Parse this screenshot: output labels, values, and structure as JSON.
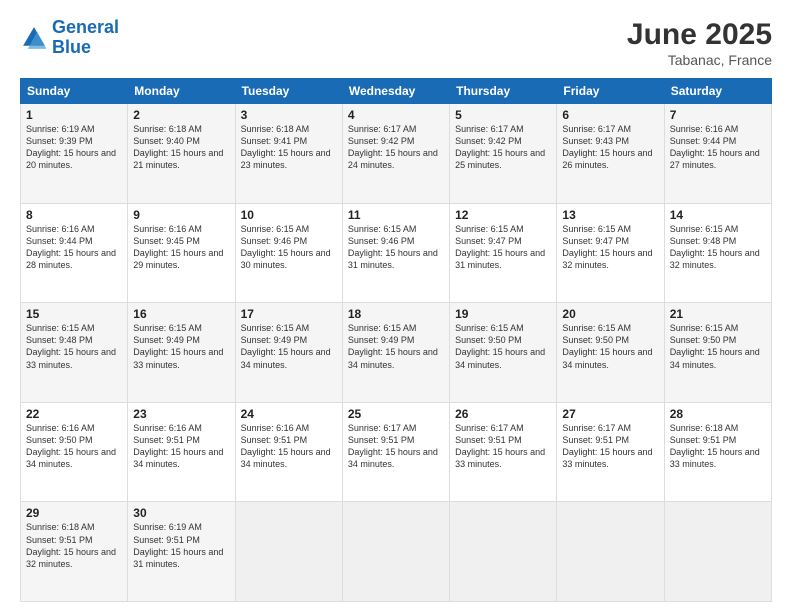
{
  "logo": {
    "line1": "General",
    "line2": "Blue"
  },
  "header": {
    "month_year": "June 2025",
    "location": "Tabanac, France"
  },
  "columns": [
    "Sunday",
    "Monday",
    "Tuesday",
    "Wednesday",
    "Thursday",
    "Friday",
    "Saturday"
  ],
  "rows": [
    [
      {
        "day": "1",
        "sunrise": "Sunrise: 6:19 AM",
        "sunset": "Sunset: 9:39 PM",
        "daylight": "Daylight: 15 hours and 20 minutes."
      },
      {
        "day": "2",
        "sunrise": "Sunrise: 6:18 AM",
        "sunset": "Sunset: 9:40 PM",
        "daylight": "Daylight: 15 hours and 21 minutes."
      },
      {
        "day": "3",
        "sunrise": "Sunrise: 6:18 AM",
        "sunset": "Sunset: 9:41 PM",
        "daylight": "Daylight: 15 hours and 23 minutes."
      },
      {
        "day": "4",
        "sunrise": "Sunrise: 6:17 AM",
        "sunset": "Sunset: 9:42 PM",
        "daylight": "Daylight: 15 hours and 24 minutes."
      },
      {
        "day": "5",
        "sunrise": "Sunrise: 6:17 AM",
        "sunset": "Sunset: 9:42 PM",
        "daylight": "Daylight: 15 hours and 25 minutes."
      },
      {
        "day": "6",
        "sunrise": "Sunrise: 6:17 AM",
        "sunset": "Sunset: 9:43 PM",
        "daylight": "Daylight: 15 hours and 26 minutes."
      },
      {
        "day": "7",
        "sunrise": "Sunrise: 6:16 AM",
        "sunset": "Sunset: 9:44 PM",
        "daylight": "Daylight: 15 hours and 27 minutes."
      }
    ],
    [
      {
        "day": "8",
        "sunrise": "Sunrise: 6:16 AM",
        "sunset": "Sunset: 9:44 PM",
        "daylight": "Daylight: 15 hours and 28 minutes."
      },
      {
        "day": "9",
        "sunrise": "Sunrise: 6:16 AM",
        "sunset": "Sunset: 9:45 PM",
        "daylight": "Daylight: 15 hours and 29 minutes."
      },
      {
        "day": "10",
        "sunrise": "Sunrise: 6:15 AM",
        "sunset": "Sunset: 9:46 PM",
        "daylight": "Daylight: 15 hours and 30 minutes."
      },
      {
        "day": "11",
        "sunrise": "Sunrise: 6:15 AM",
        "sunset": "Sunset: 9:46 PM",
        "daylight": "Daylight: 15 hours and 31 minutes."
      },
      {
        "day": "12",
        "sunrise": "Sunrise: 6:15 AM",
        "sunset": "Sunset: 9:47 PM",
        "daylight": "Daylight: 15 hours and 31 minutes."
      },
      {
        "day": "13",
        "sunrise": "Sunrise: 6:15 AM",
        "sunset": "Sunset: 9:47 PM",
        "daylight": "Daylight: 15 hours and 32 minutes."
      },
      {
        "day": "14",
        "sunrise": "Sunrise: 6:15 AM",
        "sunset": "Sunset: 9:48 PM",
        "daylight": "Daylight: 15 hours and 32 minutes."
      }
    ],
    [
      {
        "day": "15",
        "sunrise": "Sunrise: 6:15 AM",
        "sunset": "Sunset: 9:48 PM",
        "daylight": "Daylight: 15 hours and 33 minutes."
      },
      {
        "day": "16",
        "sunrise": "Sunrise: 6:15 AM",
        "sunset": "Sunset: 9:49 PM",
        "daylight": "Daylight: 15 hours and 33 minutes."
      },
      {
        "day": "17",
        "sunrise": "Sunrise: 6:15 AM",
        "sunset": "Sunset: 9:49 PM",
        "daylight": "Daylight: 15 hours and 34 minutes."
      },
      {
        "day": "18",
        "sunrise": "Sunrise: 6:15 AM",
        "sunset": "Sunset: 9:49 PM",
        "daylight": "Daylight: 15 hours and 34 minutes."
      },
      {
        "day": "19",
        "sunrise": "Sunrise: 6:15 AM",
        "sunset": "Sunset: 9:50 PM",
        "daylight": "Daylight: 15 hours and 34 minutes."
      },
      {
        "day": "20",
        "sunrise": "Sunrise: 6:15 AM",
        "sunset": "Sunset: 9:50 PM",
        "daylight": "Daylight: 15 hours and 34 minutes."
      },
      {
        "day": "21",
        "sunrise": "Sunrise: 6:15 AM",
        "sunset": "Sunset: 9:50 PM",
        "daylight": "Daylight: 15 hours and 34 minutes."
      }
    ],
    [
      {
        "day": "22",
        "sunrise": "Sunrise: 6:16 AM",
        "sunset": "Sunset: 9:50 PM",
        "daylight": "Daylight: 15 hours and 34 minutes."
      },
      {
        "day": "23",
        "sunrise": "Sunrise: 6:16 AM",
        "sunset": "Sunset: 9:51 PM",
        "daylight": "Daylight: 15 hours and 34 minutes."
      },
      {
        "day": "24",
        "sunrise": "Sunrise: 6:16 AM",
        "sunset": "Sunset: 9:51 PM",
        "daylight": "Daylight: 15 hours and 34 minutes."
      },
      {
        "day": "25",
        "sunrise": "Sunrise: 6:17 AM",
        "sunset": "Sunset: 9:51 PM",
        "daylight": "Daylight: 15 hours and 34 minutes."
      },
      {
        "day": "26",
        "sunrise": "Sunrise: 6:17 AM",
        "sunset": "Sunset: 9:51 PM",
        "daylight": "Daylight: 15 hours and 33 minutes."
      },
      {
        "day": "27",
        "sunrise": "Sunrise: 6:17 AM",
        "sunset": "Sunset: 9:51 PM",
        "daylight": "Daylight: 15 hours and 33 minutes."
      },
      {
        "day": "28",
        "sunrise": "Sunrise: 6:18 AM",
        "sunset": "Sunset: 9:51 PM",
        "daylight": "Daylight: 15 hours and 33 minutes."
      }
    ],
    [
      {
        "day": "29",
        "sunrise": "Sunrise: 6:18 AM",
        "sunset": "Sunset: 9:51 PM",
        "daylight": "Daylight: 15 hours and 32 minutes."
      },
      {
        "day": "30",
        "sunrise": "Sunrise: 6:19 AM",
        "sunset": "Sunset: 9:51 PM",
        "daylight": "Daylight: 15 hours and 31 minutes."
      },
      null,
      null,
      null,
      null,
      null
    ]
  ]
}
